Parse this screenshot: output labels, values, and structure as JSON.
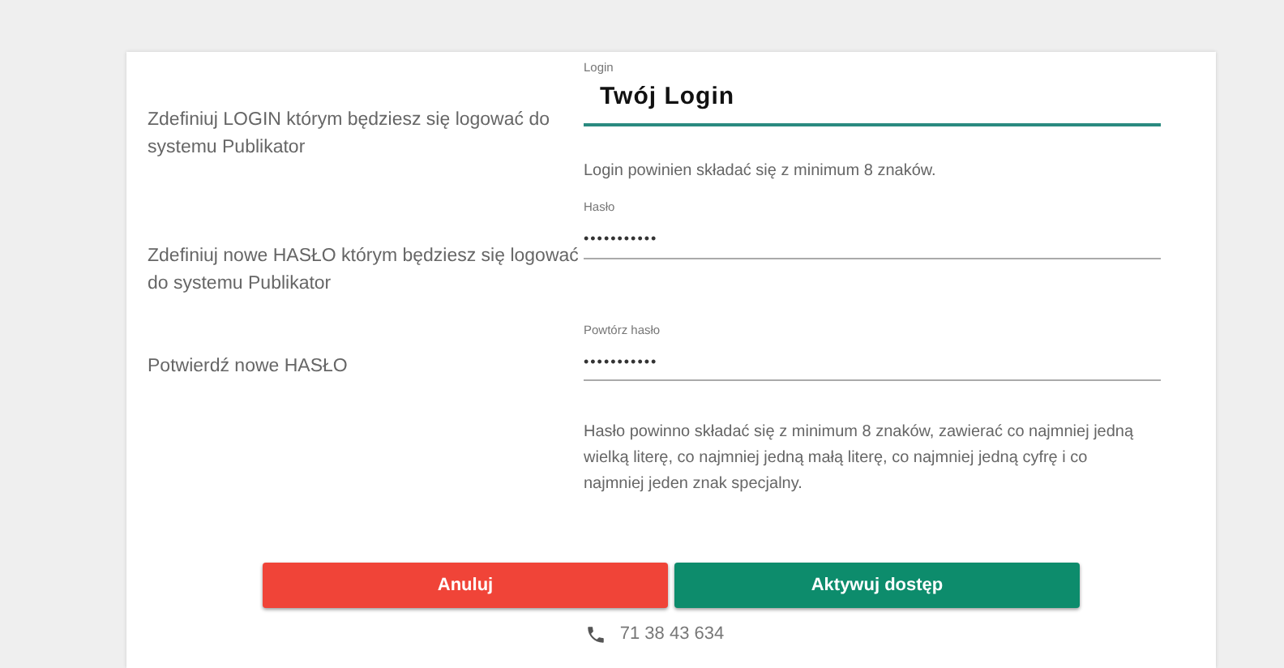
{
  "descriptions": [
    "Zdefiniuj LOGIN którym będziesz się logować do systemu Publikator",
    "Zdefiniuj nowe HASŁO którym będziesz się logować do systemu Publikator",
    "Potwierdź nowe HASŁO"
  ],
  "fields": [
    {
      "label": "Login",
      "value": "Twój Login",
      "focused": true,
      "hint": "Login powinien składać się z minimum 8 znaków."
    },
    {
      "label": "Hasło",
      "value": "•••••••••••",
      "focused": false
    },
    {
      "label": "Powtórz hasło",
      "value": "•••••••••••",
      "focused": false,
      "hint": "Hasło powinno składać się z minimum 8 znaków, zawierać co najmniej jedną wielką literę, co najmniej jedną małą literę, co najmniej jedną cyfrę i co najmniej jeden znak specjalny."
    }
  ],
  "buttons": [
    {
      "label": "Anuluj",
      "kind": "cancel"
    },
    {
      "label": "Aktywuj dostęp",
      "kind": "confirm"
    }
  ],
  "phone": "71 38 43 634"
}
